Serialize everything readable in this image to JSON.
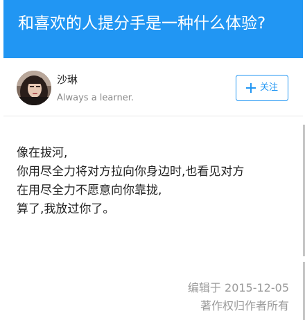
{
  "question": {
    "title": "和喜欢的人提分手是一种什么体验?"
  },
  "author": {
    "name": "沙琳",
    "bio": "Always a learner."
  },
  "follow_button": {
    "label": "关注",
    "icon": "plus-icon",
    "color": "#2196f3"
  },
  "answer": {
    "lines": [
      "像在拔河,",
      "你用尽全力将对方拉向你身边时,也看见对方",
      "在用尽全力不愿意向你靠拢,",
      "算了,我放过你了。"
    ],
    "edited": "编辑于 2015-12-05",
    "copyright": "著作权归作者所有"
  },
  "colors": {
    "accent": "#2196f3",
    "text": "#222222",
    "muted": "#9a9a9a"
  }
}
